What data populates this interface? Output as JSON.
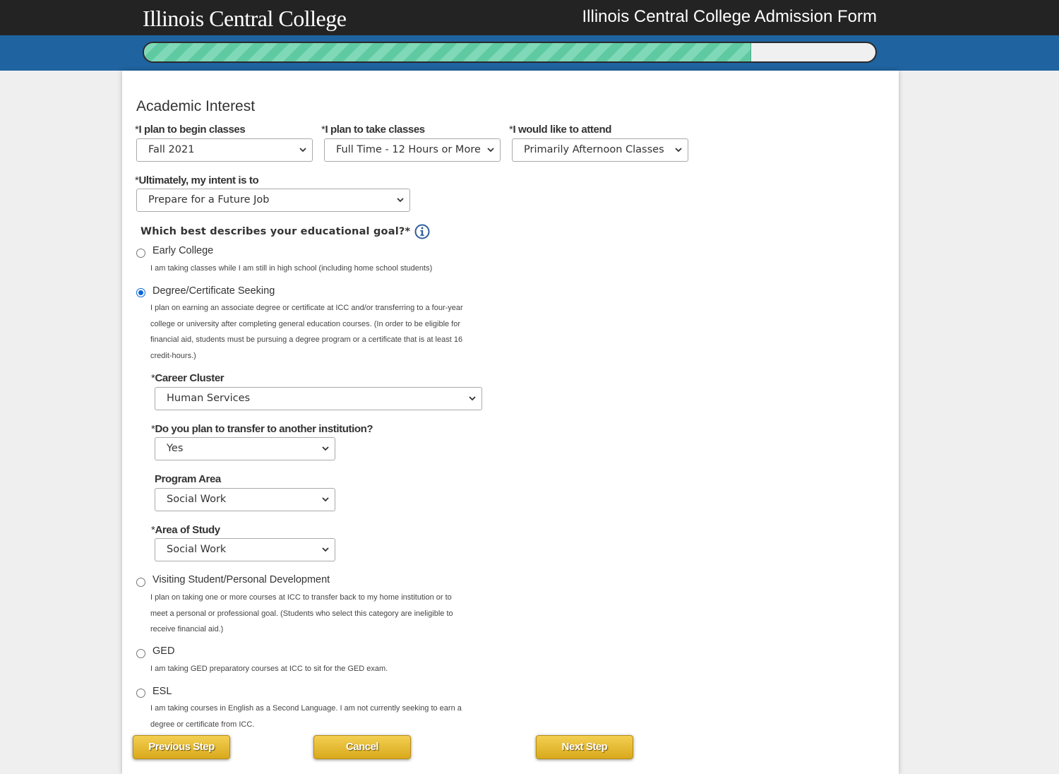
{
  "header": {
    "logo_text": "Illinois Central College",
    "form_title": "Illinois Central College Admission Form"
  },
  "progress": {
    "percent": 83
  },
  "section": {
    "title": "Academic Interest"
  },
  "fields": {
    "begin_classes": {
      "label": "I plan to begin classes",
      "value": "Fall 2021"
    },
    "take_classes": {
      "label": "I plan to take classes",
      "value": "Full Time - 12 Hours or More"
    },
    "attend": {
      "label": "I would like to attend",
      "value": "Primarily Afternoon Classes"
    },
    "intent": {
      "label": "Ultimately, my intent is to",
      "value": "Prepare for a Future Job"
    }
  },
  "required_marker": "*",
  "goal_question": "Which best describes your educational goal?*",
  "goals": [
    {
      "title": "Early College",
      "description": "I am taking classes while I am still in high school (including home school students)",
      "selected": false
    },
    {
      "title": "Degree/Certificate Seeking",
      "description_lines": [
        "I plan on earning an associate degree or certificate at ICC and/or transferring to a four-year",
        "college or university after completing general education courses. (In order to be eligible for",
        "financial aid, students must be pursuing a degree program or a certificate that is at least 16",
        "credit-hours.)"
      ],
      "selected": true
    },
    {
      "title": "Visiting Student/Personal Development",
      "description_lines": [
        "I plan on taking one or more courses at ICC to transfer back to my home institution or to",
        "meet a personal or professional goal. (Students who select this category are ineligible to",
        "receive financial aid.)"
      ],
      "selected": false
    },
    {
      "title": "GED",
      "description": "I am taking GED preparatory courses at ICC to sit for the GED exam.",
      "selected": false
    },
    {
      "title": "ESL",
      "description_lines": [
        "I am taking courses in English as a Second Language. I am not currently seeking to earn a",
        "degree or certificate from ICC."
      ],
      "selected": false
    }
  ],
  "degree_fields": {
    "career_cluster": {
      "label": "Career Cluster",
      "value": "Human Services"
    },
    "transfer": {
      "label": "Do you plan to transfer to another institution?",
      "value": "Yes"
    },
    "program_area": {
      "label": "Program Area",
      "value": "Social Work"
    },
    "area_of_study": {
      "label": "Area of Study",
      "value": "Social Work"
    }
  },
  "buttons": {
    "previous": "Previous Step",
    "cancel": "Cancel",
    "next": "Next Step"
  },
  "colors": {
    "header_bg": "#232323",
    "progress_band_bg": "#1f63a0",
    "progress_fill": "#5fcaa2",
    "button_gold": "#e6ba33",
    "radio_selected": "#0a66d6"
  }
}
